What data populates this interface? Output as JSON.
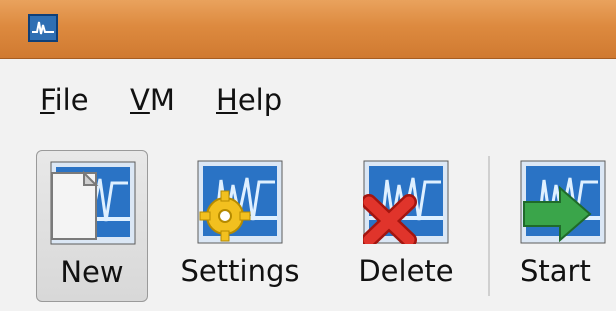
{
  "window": {
    "app_icon": "virtualbox-monitor-icon"
  },
  "menubar": {
    "items": [
      {
        "label": "File",
        "mnemonic": "F"
      },
      {
        "label": "VM",
        "mnemonic": "V"
      },
      {
        "label": "Help",
        "mnemonic": "H"
      }
    ]
  },
  "toolbar": {
    "buttons": [
      {
        "label": "New",
        "icon": "new-vm-icon",
        "active": true
      },
      {
        "label": "Settings",
        "icon": "settings-gear-icon",
        "active": false
      },
      {
        "label": "Delete",
        "icon": "delete-x-icon",
        "active": false
      },
      {
        "label": "Start",
        "icon": "start-arrow-icon",
        "active": false
      }
    ]
  },
  "colors": {
    "titlebar": "#dd8a3f",
    "screen_blue": "#2a73c5",
    "gear_yellow": "#f2c01f",
    "delete_red": "#e0342b",
    "start_green": "#3aa54a"
  }
}
